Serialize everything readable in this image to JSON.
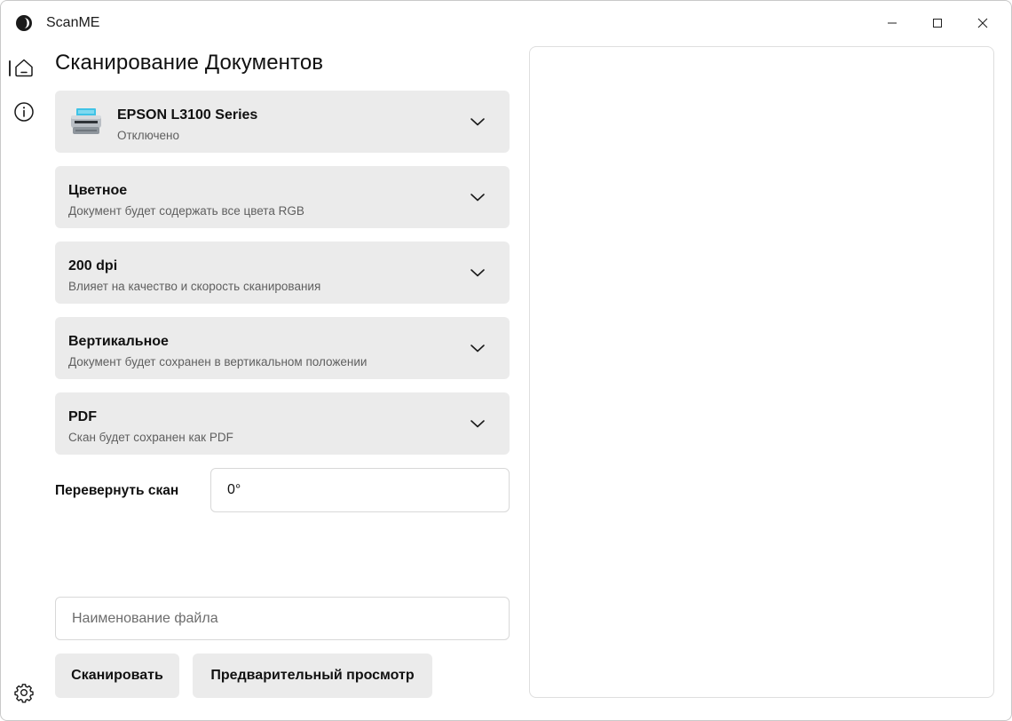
{
  "app": {
    "title": "ScanME"
  },
  "page": {
    "title": "Сканирование Документов"
  },
  "nav": {
    "items": [
      {
        "name": "home-icon",
        "active": true
      },
      {
        "name": "info-icon",
        "active": false
      }
    ],
    "bottom": {
      "name": "gear-icon"
    }
  },
  "options": {
    "printer": {
      "title": "EPSON L3100 Series",
      "subtitle": "Отключено",
      "icon": "printer-icon"
    },
    "color": {
      "title": "Цветное",
      "subtitle": "Документ будет содержать все цвета RGB"
    },
    "resolution": {
      "title": "200 dpi",
      "subtitle": "Влияет на качество и скорость сканирования"
    },
    "orientation": {
      "title": "Вертикальное",
      "subtitle": "Документ будет сохранен в вертикальном положении"
    },
    "format": {
      "title": "PDF",
      "subtitle": "Скан будет сохранен как PDF"
    }
  },
  "rotate": {
    "label": "Перевернуть скан",
    "value": "0°"
  },
  "filename": {
    "placeholder": "Наименование файла",
    "value": ""
  },
  "actions": {
    "scan_label": "Сканировать",
    "preview_label": "Предварительный просмотр"
  },
  "colors": {
    "card_bg": "#ebebeb",
    "accent_printer": "#3fc3e6",
    "text": "#111111",
    "subtext": "#5f5f5f"
  }
}
